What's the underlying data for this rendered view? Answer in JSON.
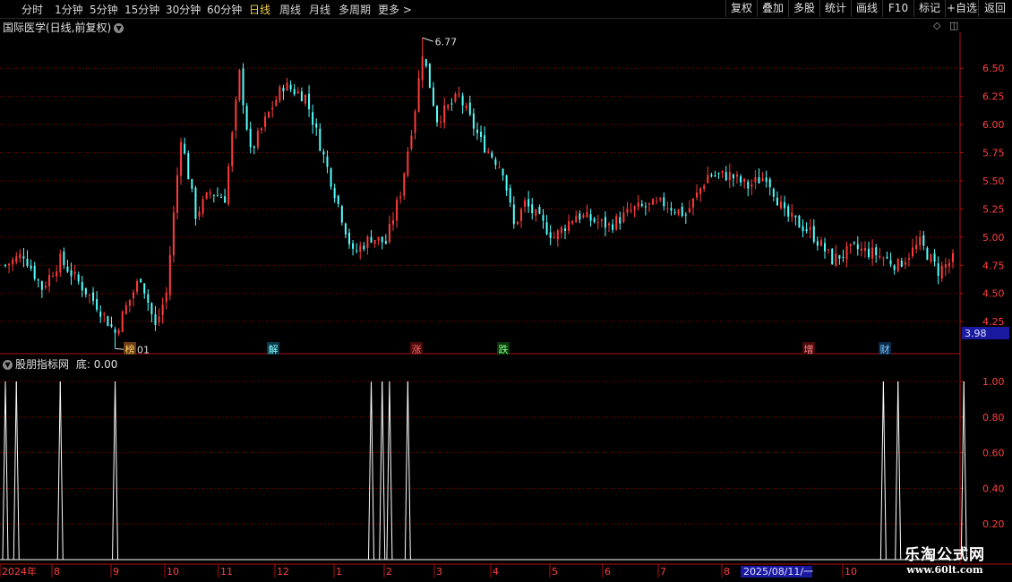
{
  "toolbar": {
    "periods": [
      "分时",
      "1分钟",
      "5分钟",
      "15分钟",
      "30分钟",
      "60分钟",
      "日线",
      "周线",
      "月线",
      "多周期",
      "更多 >"
    ],
    "active_period": "日线",
    "buttons": [
      "复权",
      "叠加",
      "多股",
      "统计",
      "画线",
      "F10",
      "标记",
      "+自选",
      "返回"
    ]
  },
  "main_panel": {
    "title": "国际医学(日线,前复权)",
    "high_label": "6.77",
    "low_label": "4.01",
    "current_price_tag": "3.98",
    "event_markers": [
      "榜",
      "解",
      "涨",
      "跌",
      "增",
      "财"
    ]
  },
  "indicator_panel": {
    "title": "股朋指标网",
    "value_label": "底: 0.00"
  },
  "chart_data": [
    {
      "type": "candlestick",
      "title": "国际医学(日线,前复权)",
      "y_ticks": [
        "6.50",
        "6.25",
        "6.00",
        "5.75",
        "5.50",
        "5.25",
        "5.00",
        "4.75",
        "4.50",
        "4.25"
      ],
      "ylim": [
        4.1,
        6.82
      ],
      "x_tick_labels": [
        "2024年",
        "8",
        "9",
        "10",
        "11",
        "12",
        "1",
        "2",
        "3",
        "4",
        "5",
        "6",
        "7",
        "8",
        "10"
      ],
      "date_tag": "2025/08/11/一",
      "highest": 6.77,
      "lowest": 4.01,
      "anchor_points": [
        {
          "i": 0,
          "v": 4.75
        },
        {
          "i": 5,
          "v": 4.85
        },
        {
          "i": 10,
          "v": 4.55
        },
        {
          "i": 15,
          "v": 4.8
        },
        {
          "i": 25,
          "v": 4.4
        },
        {
          "i": 30,
          "v": 4.15
        },
        {
          "i": 33,
          "v": 4.38
        },
        {
          "i": 37,
          "v": 4.65
        },
        {
          "i": 41,
          "v": 4.2
        },
        {
          "i": 44,
          "v": 4.5
        },
        {
          "i": 48,
          "v": 5.9
        },
        {
          "i": 52,
          "v": 5.2
        },
        {
          "i": 56,
          "v": 5.4
        },
        {
          "i": 60,
          "v": 5.35
        },
        {
          "i": 64,
          "v": 6.45
        },
        {
          "i": 67,
          "v": 5.75
        },
        {
          "i": 72,
          "v": 6.1
        },
        {
          "i": 76,
          "v": 6.35
        },
        {
          "i": 82,
          "v": 6.25
        },
        {
          "i": 90,
          "v": 5.4
        },
        {
          "i": 95,
          "v": 4.85
        },
        {
          "i": 100,
          "v": 5.0
        },
        {
          "i": 104,
          "v": 4.95
        },
        {
          "i": 108,
          "v": 5.4
        },
        {
          "i": 112,
          "v": 6.15
        },
        {
          "i": 114,
          "v": 6.65
        },
        {
          "i": 118,
          "v": 6.05
        },
        {
          "i": 124,
          "v": 6.25
        },
        {
          "i": 130,
          "v": 5.85
        },
        {
          "i": 136,
          "v": 5.6
        },
        {
          "i": 139,
          "v": 5.1
        },
        {
          "i": 142,
          "v": 5.3
        },
        {
          "i": 150,
          "v": 5.0
        },
        {
          "i": 156,
          "v": 5.2
        },
        {
          "i": 165,
          "v": 5.1
        },
        {
          "i": 172,
          "v": 5.25
        },
        {
          "i": 180,
          "v": 5.3
        },
        {
          "i": 186,
          "v": 5.2
        },
        {
          "i": 192,
          "v": 5.55
        },
        {
          "i": 198,
          "v": 5.55
        },
        {
          "i": 203,
          "v": 5.45
        },
        {
          "i": 208,
          "v": 5.55
        },
        {
          "i": 213,
          "v": 5.2
        },
        {
          "i": 220,
          "v": 5.05
        },
        {
          "i": 226,
          "v": 4.8
        },
        {
          "i": 232,
          "v": 4.9
        },
        {
          "i": 238,
          "v": 4.85
        },
        {
          "i": 244,
          "v": 4.75
        },
        {
          "i": 250,
          "v": 4.95
        },
        {
          "i": 255,
          "v": 4.7
        },
        {
          "i": 259,
          "v": 4.8
        }
      ]
    },
    {
      "type": "line",
      "title": "股朋指标网",
      "y_ticks": [
        "1.00",
        "0.80",
        "0.60",
        "0.40",
        "0.20"
      ],
      "ylim": [
        0,
        1.05
      ],
      "signal_indices": [
        0,
        3,
        15,
        30,
        100,
        103,
        105,
        110,
        240,
        244,
        262
      ]
    }
  ],
  "colors": {
    "background": "#000000",
    "up": "#ff3b3b",
    "down": "#54ffff",
    "grid": "#8b0000",
    "axis": "#b01010",
    "label": "#ff4040",
    "price_tag_bg": "#1a1aa0",
    "signal_line": "#ffffff"
  },
  "watermark": {
    "line1": "乐淘公式网",
    "line2": "www.60lt.com"
  }
}
